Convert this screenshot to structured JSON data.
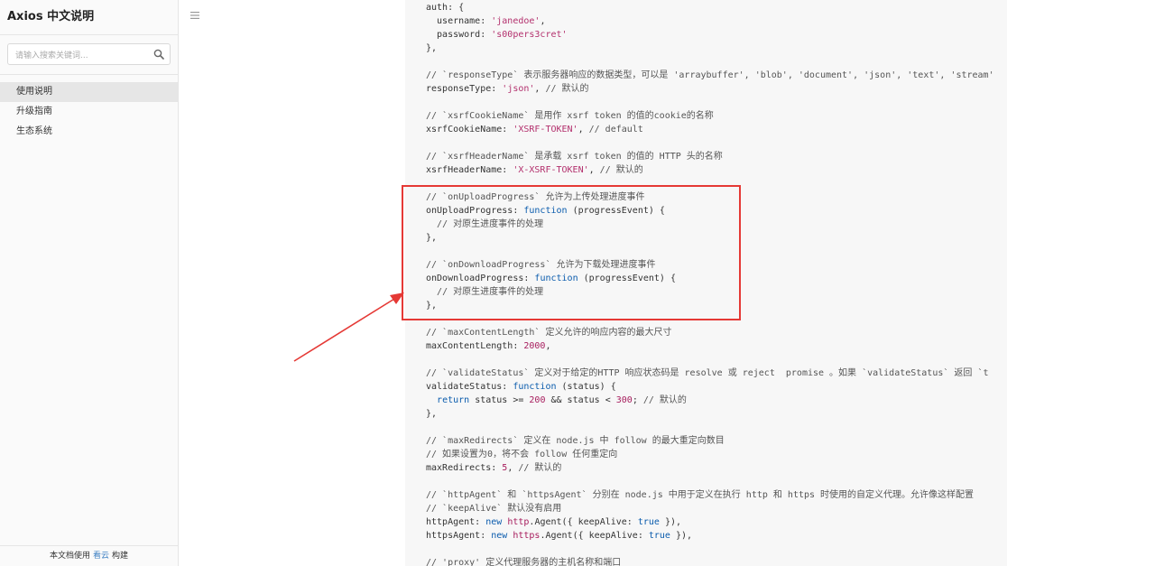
{
  "sidebar": {
    "title": "Axios 中文说明",
    "search_placeholder": "请输入搜索关键词...",
    "items": [
      {
        "label": "使用说明",
        "active": true
      },
      {
        "label": "升级指南",
        "active": false
      },
      {
        "label": "生态系统",
        "active": false
      }
    ],
    "footer": {
      "prefix": "本文档使用",
      "link": "看云",
      "suffix": "构建"
    }
  },
  "icons": {
    "menu": "hamburger-menu-icon",
    "search": "search-icon"
  },
  "colors": {
    "annotation": "#e53935",
    "code_bg": "#f7f7f7",
    "sidebar_bg": "#fafafa"
  },
  "code_lines": [
    "auth: {",
    "  username: 'janedoe',",
    "  password: 's00pers3cret'",
    "},",
    "",
    "// `responseType` 表示服务器响应的数据类型，可以是 'arraybuffer', 'blob', 'document', 'json', 'text', 'stream'",
    "responseType: 'json', // 默认的",
    "",
    "// `xsrfCookieName` 是用作 xsrf token 的值的cookie的名称",
    "xsrfCookieName: 'XSRF-TOKEN', // default",
    "",
    "// `xsrfHeaderName` 是承载 xsrf token 的值的 HTTP 头的名称",
    "xsrfHeaderName: 'X-XSRF-TOKEN', // 默认的",
    "",
    "// `onUploadProgress` 允许为上传处理进度事件",
    "onUploadProgress: function (progressEvent) {",
    "  // 对原生进度事件的处理",
    "},",
    "",
    "// `onDownloadProgress` 允许为下载处理进度事件",
    "onDownloadProgress: function (progressEvent) {",
    "  // 对原生进度事件的处理",
    "},",
    "",
    "// `maxContentLength` 定义允许的响应内容的最大尺寸",
    "maxContentLength: 2000,",
    "",
    "// `validateStatus` 定义对于给定的HTTP 响应状态码是 resolve 或 reject  promise 。如果 `validateStatus` 返回 `t",
    "validateStatus: function (status) {",
    "  return status >= 200 && status < 300; // 默认的",
    "},",
    "",
    "// `maxRedirects` 定义在 node.js 中 follow 的最大重定向数目",
    "// 如果设置为0，将不会 follow 任何重定向",
    "maxRedirects: 5, // 默认的",
    "",
    "// `httpAgent` 和 `httpsAgent` 分别在 node.js 中用于定义在执行 http 和 https 时使用的自定义代理。允许像这样配置",
    "// `keepAlive` 默认没有启用",
    "httpAgent: new http.Agent({ keepAlive: true }),",
    "httpsAgent: new https.Agent({ keepAlive: true }),",
    "",
    "// 'proxy' 定义代理服务器的主机名称和端口"
  ]
}
